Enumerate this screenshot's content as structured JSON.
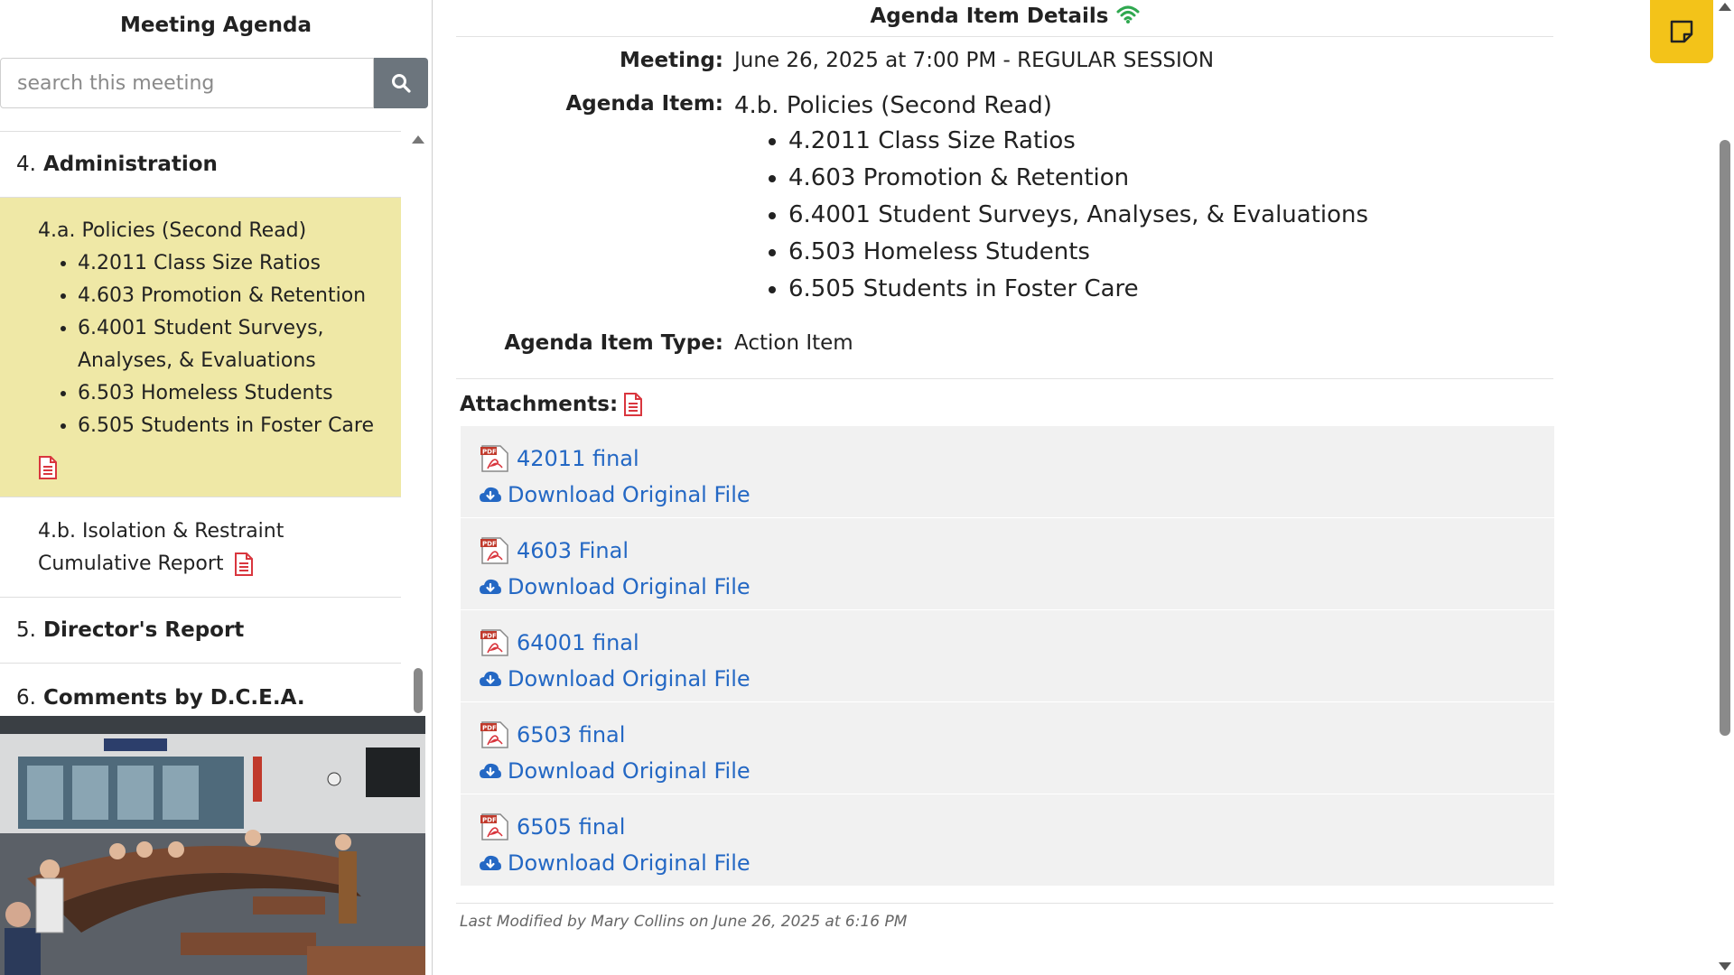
{
  "sidebar": {
    "title": "Meeting Agenda",
    "search_placeholder": "search this meeting",
    "sections": [
      {
        "number": "4.",
        "title": "Administration"
      },
      {
        "number": "5.",
        "title": "Director's Report"
      },
      {
        "number": "6.",
        "title": "Comments by D.C.E.A."
      }
    ],
    "active_item": {
      "title": "4.a. Policies (Second Read)",
      "bullets": [
        "4.2011 Class Size Ratios",
        "4.603 Promotion & Retention",
        "6.4001 Student Surveys, Analyses, & Evaluations",
        "6.503 Homeless Students",
        "6.505 Students in Foster Care"
      ]
    },
    "other_item": {
      "title": "4.b. Isolation & Restraint Cumulative Report"
    }
  },
  "main": {
    "title": "Agenda Item Details",
    "meeting_label": "Meeting:",
    "meeting_value": "June 26, 2025 at 7:00 PM - REGULAR SESSION",
    "item_label": "Agenda Item:",
    "item_value": "4.b. Policies (Second Read)",
    "item_bullets": [
      "4.2011 Class Size Ratios",
      "4.603 Promotion & Retention",
      "6.4001 Student Surveys, Analyses, & Evaluations",
      "6.503 Homeless Students",
      "6.505 Students in Foster Care"
    ],
    "type_label": "Agenda Item Type:",
    "type_value": "Action Item",
    "attachments_label": "Attachments:",
    "attachments": [
      {
        "name": "42011 final",
        "download": "Download Original File"
      },
      {
        "name": "4603 Final",
        "download": "Download Original File"
      },
      {
        "name": "64001 final",
        "download": "Download Original File"
      },
      {
        "name": "6503 final",
        "download": "Download Original File"
      },
      {
        "name": "6505 final",
        "download": "Download Original File"
      }
    ],
    "modified": "Last Modified by Mary Collins on June 26, 2025 at 6:16 PM"
  },
  "colors": {
    "active_item_bg": "#efe8a6",
    "link": "#2468c4",
    "pdf_red": "#d9363e",
    "wifi_green": "#2fa84f",
    "note_button": "#f3c319",
    "search_button": "#6c757d"
  },
  "icons": {
    "search": "search-icon",
    "wifi": "wifi-icon",
    "document": "document-icon",
    "pdf": "pdf-file-icon",
    "download": "cloud-download-icon",
    "note": "sticky-note-icon"
  }
}
